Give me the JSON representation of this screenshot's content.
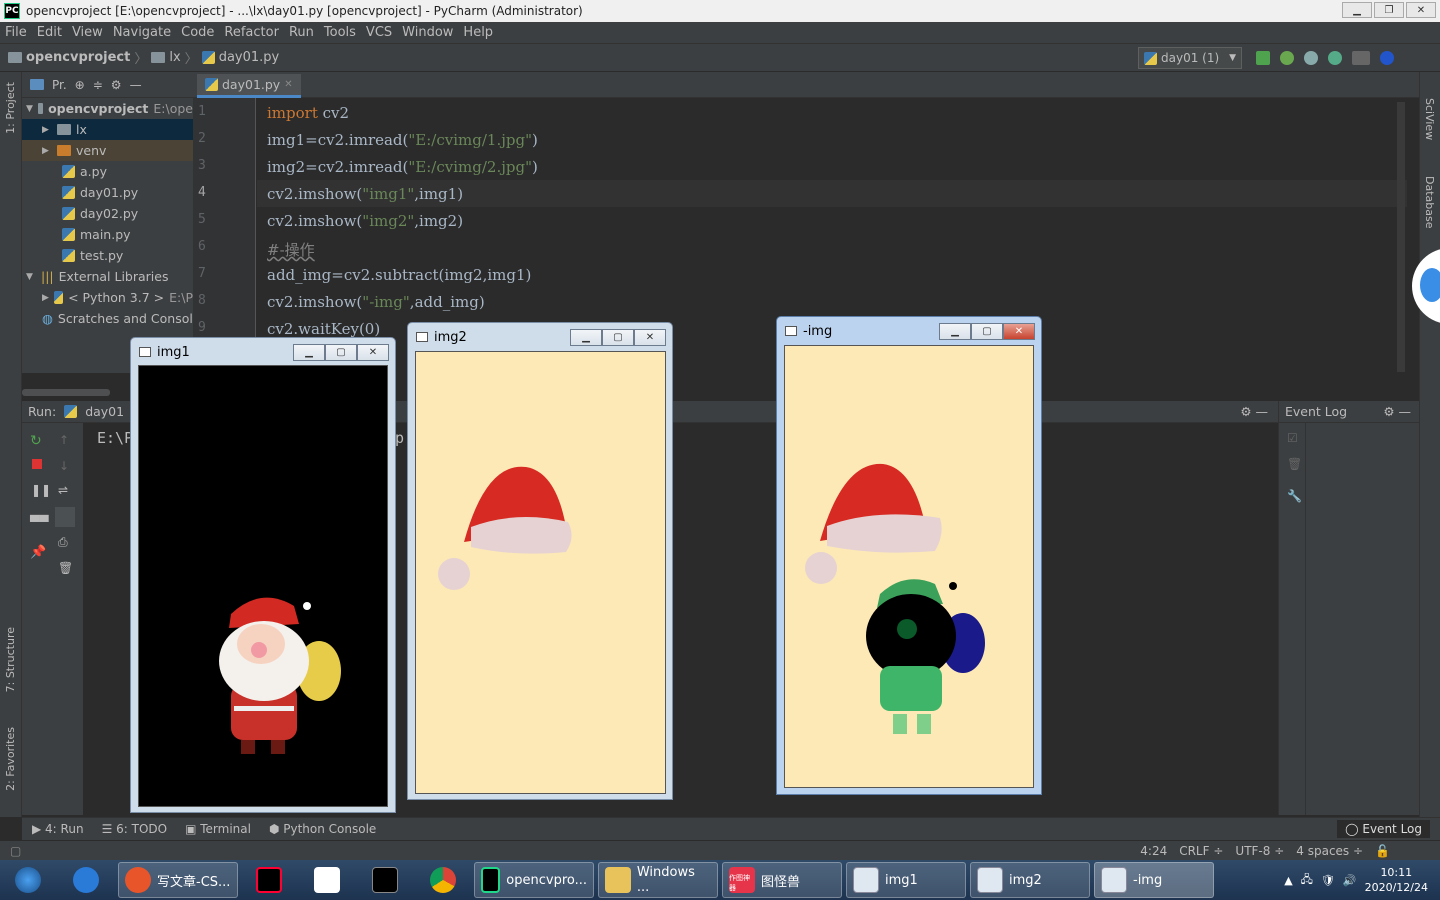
{
  "window": {
    "title": "opencvproject [E:\\opencvproject] - ...\\lx\\day01.py [opencvproject] - PyCharm (Administrator)",
    "logo": "PC"
  },
  "menu": [
    "File",
    "Edit",
    "View",
    "Navigate",
    "Code",
    "Refactor",
    "Run",
    "Tools",
    "VCS",
    "Window",
    "Help"
  ],
  "nav": {
    "project": "opencvproject",
    "folder": "lx",
    "file": "day01.py"
  },
  "run_config": "day01 (1)",
  "project_panel": {
    "header": "Pr.",
    "root": "opencvproject",
    "root_path": "E:\\ope",
    "items": [
      "lx",
      "venv",
      "a.py",
      "day01.py",
      "day02.py",
      "main.py",
      "test.py"
    ],
    "external": "External Libraries",
    "python": "< Python 3.7 >",
    "python_path": "E:\\P",
    "scratches": "Scratches and Console"
  },
  "left_strip": {
    "project": "1: Project",
    "structure": "7: Structure",
    "favorites": "2: Favorites"
  },
  "right_strip": {
    "sciview": "SciView",
    "database": "Database"
  },
  "editor": {
    "tab": "day01.py",
    "line_numbers": [
      "1",
      "2",
      "3",
      "4",
      "5",
      "6",
      "7",
      "8",
      "9"
    ],
    "lines": [
      "import cv2",
      "img1=cv2.imread(\"E:/cvimg/1.jpg\")",
      "img2=cv2.imread(\"E:/cvimg/2.jpg\")",
      "cv2.imshow(\"img1\",img1)",
      "cv2.imshow(\"img2\",img2)",
      "#-操作",
      "add_img=cv2.subtract(img2,img1)",
      "cv2.imshow(\"-img\",add_img)",
      "cv2.waitKey(0)"
    ]
  },
  "run_panel": {
    "label": "Run:",
    "config": "day01",
    "output": "E:\\P",
    "output2": "p",
    "event_log": "Event Log"
  },
  "bottom_tabs": [
    "4: Run",
    "6: TODO",
    "Terminal",
    "Python Console"
  ],
  "bottom_event_log": "Event Log",
  "status": {
    "position": "4:24",
    "line_sep": "CRLF ÷",
    "encoding": "UTF-8 ÷",
    "indent": "4 spaces ÷"
  },
  "cv_windows": {
    "w1": "img1",
    "w2": "img2",
    "w3": "-img"
  },
  "taskbar": {
    "items": [
      "写文章-CS...",
      "opencvpro...",
      "Windows ...",
      "图怪兽",
      "img1",
      "img2",
      "-img"
    ],
    "tuguai_badge": "作图神器",
    "time": "10:11",
    "date": "2020/12/24"
  },
  "colors": {
    "accent": "#4a88c7",
    "canvas_bg": "#fde9b6",
    "hat_red": "#d62a22"
  }
}
